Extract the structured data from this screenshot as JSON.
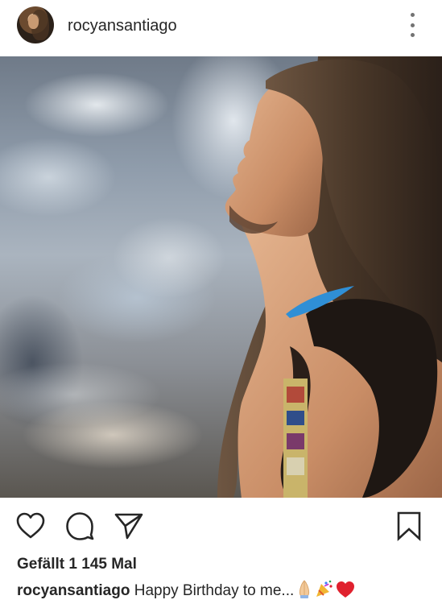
{
  "header": {
    "username": "rocyansantiago",
    "avatar_icon": "profile-avatar",
    "more_icon": "more-vertical-icon"
  },
  "post": {
    "image_icon": "post-photo"
  },
  "actions": {
    "like_icon": "heart-outline-icon",
    "comment_icon": "comment-bubble-icon",
    "share_icon": "paper-plane-icon",
    "save_icon": "bookmark-outline-icon"
  },
  "likes_text": "Gefällt 1 145 Mal",
  "caption": {
    "username": "rocyansantiago",
    "text": "Happy Birthday to me...",
    "emojis": [
      "folded-hands-emoji",
      "party-popper-emoji",
      "red-heart-emoji"
    ]
  },
  "colors": {
    "text": "#262626",
    "icon_gray": "#737373",
    "background": "#ffffff",
    "heart_red": "#e0212e"
  }
}
